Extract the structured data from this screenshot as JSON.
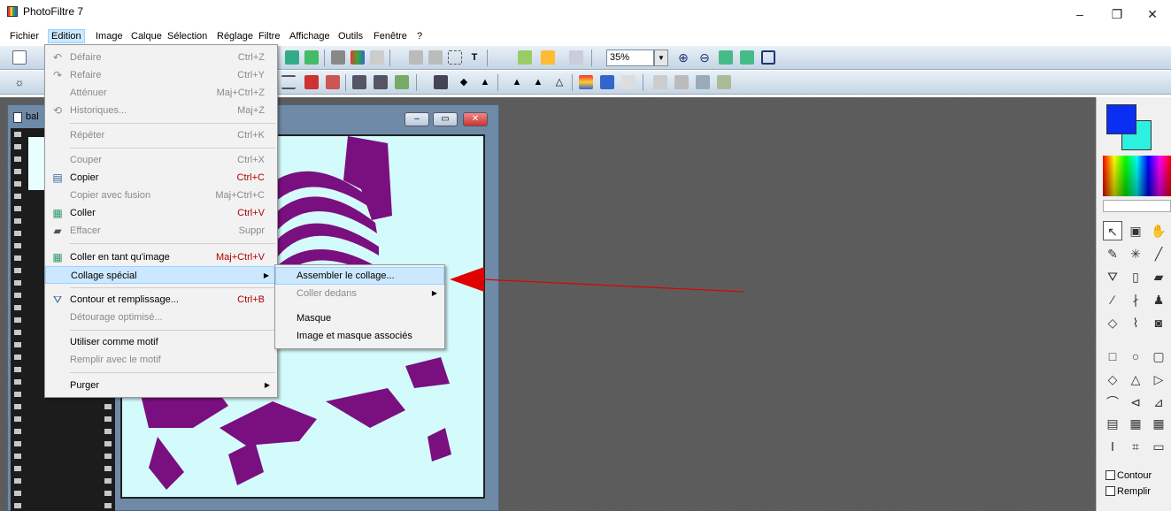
{
  "app": {
    "title": "PhotoFiltre 7",
    "window_controls": [
      "–",
      "❐",
      "✕"
    ]
  },
  "menubar": {
    "items": [
      "Fichier",
      "Edition",
      "Image",
      "Calque",
      "Sélection",
      "Réglage",
      "Filtre",
      "Affichage",
      "Outils",
      "Fenêtre",
      "?"
    ],
    "active": "Edition"
  },
  "toolbar": {
    "zoom_value": "35%",
    "zoom_in_icon": "zoom-in-icon",
    "zoom_out_icon": "zoom-out-icon"
  },
  "document": {
    "title": "bal",
    "controls": [
      "–",
      "▭",
      "✕"
    ]
  },
  "edition_menu": {
    "items": [
      {
        "label": "Défaire",
        "shortcut": "Ctrl+Z",
        "icon": "undo-icon",
        "disabled": true
      },
      {
        "label": "Refaire",
        "shortcut": "Ctrl+Y",
        "icon": "redo-icon",
        "disabled": true
      },
      {
        "label": "Atténuer",
        "shortcut": "Maj+Ctrl+Z",
        "disabled": true
      },
      {
        "label": "Historiques...",
        "shortcut": "Maj+Z",
        "icon": "history-icon",
        "disabled": true
      },
      {
        "label": "Répéter",
        "shortcut": "Ctrl+K",
        "disabled": true
      },
      {
        "label": "Couper",
        "shortcut": "Ctrl+X",
        "disabled": true
      },
      {
        "label": "Copier",
        "shortcut": "Ctrl+C",
        "icon": "copy-icon",
        "disabled": false
      },
      {
        "label": "Copier avec fusion",
        "shortcut": "Maj+Ctrl+C",
        "disabled": true
      },
      {
        "label": "Coller",
        "shortcut": "Ctrl+V",
        "icon": "paste-icon",
        "disabled": false
      },
      {
        "label": "Effacer",
        "shortcut": "Suppr",
        "icon": "eraser-icon",
        "disabled": true
      },
      {
        "label": "Coller en tant qu'image",
        "shortcut": "Maj+Ctrl+V",
        "icon": "paste-image-icon",
        "disabled": false
      },
      {
        "label": "Collage spécial",
        "submenu": true,
        "highlighted": true
      },
      {
        "label": "Contour et remplissage...",
        "shortcut": "Ctrl+B",
        "icon": "fill-icon",
        "disabled": false
      },
      {
        "label": "Détourage optimisé...",
        "disabled": true
      },
      {
        "label": "Utiliser comme motif",
        "disabled": false
      },
      {
        "label": "Remplir avec le motif",
        "disabled": true
      },
      {
        "label": "Purger",
        "submenu": true,
        "disabled": false
      }
    ]
  },
  "collage_submenu": {
    "items": [
      {
        "label": "Assembler le collage...",
        "highlighted": true
      },
      {
        "label": "Coller dedans",
        "submenu": true,
        "disabled": true
      },
      {
        "label": "Masque",
        "disabled": false
      },
      {
        "label": "Image et masque associés",
        "disabled": false
      }
    ]
  },
  "right_panel": {
    "checkboxes": [
      {
        "label": "Contour",
        "checked": false
      },
      {
        "label": "Remplir",
        "checked": false
      }
    ],
    "colors": {
      "foreground": "#0a2ef2",
      "background": "#2ef0e0"
    }
  },
  "colors": {
    "menu_highlight": "#cce8ff",
    "shortcut_red": "#b00000",
    "image_subject": "#7a0f80",
    "image_background": "#d4fbfb",
    "annotation_arrow": "#e00000"
  }
}
